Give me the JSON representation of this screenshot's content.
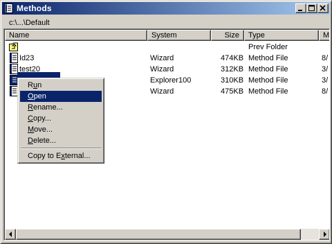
{
  "window": {
    "title": "Methods"
  },
  "path": "c:\\...\\Default",
  "columns": [
    {
      "key": "name",
      "label": "Name"
    },
    {
      "key": "system",
      "label": "System"
    },
    {
      "key": "size",
      "label": "Size"
    },
    {
      "key": "type",
      "label": "Type"
    },
    {
      "key": "modified",
      "label": "Mo"
    }
  ],
  "rows": [
    {
      "name": "",
      "system": "",
      "size": "",
      "type": "Prev Folder",
      "modified": "",
      "icon": "folder-up-icon"
    },
    {
      "name": "Id23",
      "system": "Wizard",
      "size": "474KB",
      "type": "Method File",
      "modified": "8/",
      "icon": "method-file-icon"
    },
    {
      "name": "test20",
      "system": "Wizard",
      "size": "312KB",
      "type": "Method File",
      "modified": "3/",
      "icon": "method-file-icon"
    },
    {
      "name": "",
      "system": "Explorer100",
      "size": "310KB",
      "type": "Method File",
      "modified": "3/",
      "icon": "method-file-icon"
    },
    {
      "name": "",
      "system": "Wizard",
      "size": "475KB",
      "type": "Method File",
      "modified": "8/",
      "icon": "method-file-icon"
    }
  ],
  "context_menu": {
    "items": [
      {
        "pre": "R",
        "acc": "u",
        "post": "n",
        "selected": false
      },
      {
        "pre": "",
        "acc": "O",
        "post": "pen",
        "selected": true
      },
      {
        "pre": "",
        "acc": "R",
        "post": "ename...",
        "selected": false
      },
      {
        "pre": "",
        "acc": "C",
        "post": "opy...",
        "selected": false
      },
      {
        "pre": "",
        "acc": "M",
        "post": "ove...",
        "selected": false
      },
      {
        "pre": "",
        "acc": "D",
        "post": "elete...",
        "selected": false
      },
      {
        "pre": "Copy to E",
        "acc": "x",
        "post": "ternal...",
        "selected": false
      }
    ]
  },
  "colors": {
    "title_start": "#0a246a",
    "title_end": "#a6caf0",
    "selection": "#0a246a",
    "face": "#d4d0c8"
  }
}
